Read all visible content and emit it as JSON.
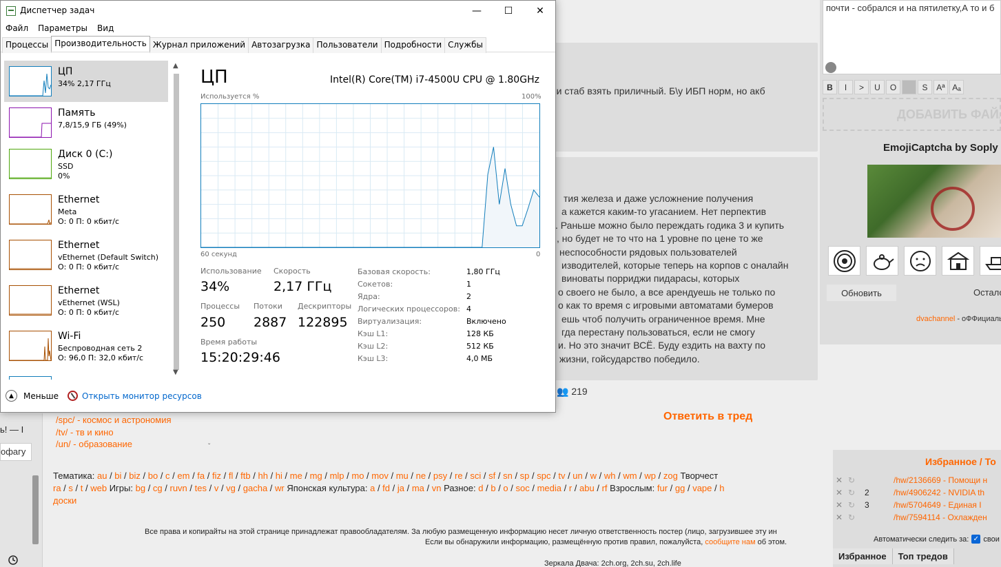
{
  "task_manager": {
    "window_title": "Диспетчер задач",
    "controls": {
      "minimize": "—",
      "maximize": "☐",
      "close": "✕"
    },
    "menu": [
      "Файл",
      "Параметры",
      "Вид"
    ],
    "tabs": [
      "Процессы",
      "Производительность",
      "Журнал приложений",
      "Автозагрузка",
      "Пользователи",
      "Подробности",
      "Службы"
    ],
    "active_tab": "Производительность",
    "sidebar": [
      {
        "name": "ЦП",
        "sub1": "34% 2,17 ГГц",
        "sub2": "",
        "color": "#117dbb",
        "selected": true
      },
      {
        "name": "Память",
        "sub1": "7,8/15,9 ГБ (49%)",
        "sub2": "",
        "color": "#8b12ae",
        "selected": false
      },
      {
        "name": "Диск 0 (C:)",
        "sub1": "SSD",
        "sub2": "0%",
        "color": "#4da60c",
        "selected": false
      },
      {
        "name": "Ethernet",
        "sub1": "Meta",
        "sub2": "О: 0 П: 0 кбит/с",
        "color": "#a74f01",
        "selected": false
      },
      {
        "name": "Ethernet",
        "sub1": "vEthernet (Default Switch)",
        "sub2": "О: 0 П: 0 кбит/с",
        "color": "#a74f01",
        "selected": false
      },
      {
        "name": "Ethernet",
        "sub1": "vEthernet (WSL)",
        "sub2": "О: 0 П: 0 кбит/с",
        "color": "#a74f01",
        "selected": false
      },
      {
        "name": "Wi-Fi",
        "sub1": "Беспроводная сеть 2",
        "sub2": "О: 96,0 П: 32,0 кбит/с",
        "color": "#a74f01",
        "selected": false
      }
    ],
    "cpu": {
      "title": "ЦП",
      "model": "Intel(R) Core(TM) i7-4500U CPU @ 1.80GHz",
      "graph_label_top_left": "Используется %",
      "graph_label_top_right": "100%",
      "graph_label_bottom_left": "60 секунд",
      "graph_label_bottom_right": "0",
      "usage_label": "Использование",
      "usage": "34%",
      "speed_label": "Скорость",
      "speed": "2,17 ГГц",
      "processes_label": "Процессы",
      "processes": "250",
      "threads_label": "Потоки",
      "threads": "2887",
      "handles_label": "Дескрипторы",
      "handles": "122895",
      "uptime_label": "Время работы",
      "uptime": "15:20:29:46",
      "details": [
        {
          "k": "Базовая скорость:",
          "v": "1,80 ГГц"
        },
        {
          "k": "Сокетов:",
          "v": "1"
        },
        {
          "k": "Ядра:",
          "v": "2"
        },
        {
          "k": "Логических процессоров:",
          "v": "4"
        },
        {
          "k": "Виртуализация:",
          "v": "Включено"
        },
        {
          "k": "Кэш L1:",
          "v": "128 КБ"
        },
        {
          "k": "Кэш L2:",
          "v": "512 КБ"
        },
        {
          "k": "Кэш L3:",
          "v": "4,0 МБ"
        }
      ],
      "graph_series_pct": [
        0,
        0,
        0,
        0,
        0,
        0,
        0,
        0,
        0,
        0,
        0,
        0,
        0,
        0,
        0,
        0,
        0,
        0,
        0,
        0,
        0,
        0,
        0,
        0,
        0,
        0,
        0,
        0,
        0,
        0,
        0,
        0,
        0,
        0,
        0,
        0,
        0,
        0,
        0,
        0,
        0,
        0,
        0,
        0,
        0,
        0,
        0,
        0,
        0,
        0,
        51,
        70,
        30,
        55,
        30,
        15,
        15,
        27,
        40,
        35
      ]
    },
    "fewer_details": "Меньше",
    "open_monitor": "Открыть монитор ресурсов"
  },
  "forum": {
    "post1_text": "о и стаб взять приличный. Б\\у ИБП норм, но акб",
    "post2_lines": [
      "тия железа и даже усложнение получения",
      "а кажется каким-то угасанием. Нет перпектив",
      ". Раньше можно было переждать годика 3 и купить",
      ", но будет не то что на 1 уровне по цене то же",
      "неспособности рядовых пользователей",
      "изводителей, которые теперь на корпов с оналайн",
      "виноваты порриджи пидарасы, которых",
      "о своего не было, а все арендуешь не только по",
      "о как то время с игровыми автоматами бумеров",
      "ешь чтоб получить ограниченное время. Мне",
      "гда перестану пользоваться, если не смогу",
      "и. Но это значит ВСЁ. Буду ездить на вахту по",
      "жизни, гойсударство победило."
    ],
    "counter": "219",
    "reply_in_thread": "Ответить в тред",
    "reply_box_text": "почти - собрался и на пятилетку,А то и б",
    "format_buttons": [
      "B",
      "I",
      ">",
      "U",
      "O",
      "",
      "S",
      "Aª",
      "Aₐ"
    ],
    "add_file": "ДОБАВИТЬ ФАЙЛ",
    "captcha_title": "EmojiCaptcha by Soply",
    "refresh": "Обновить",
    "remaining": "Остало",
    "dvachannel": "dvachannel",
    "dvachannel_suffix": " - оФФициаль",
    "boards": [
      "/spc/ - космос и астрономия",
      "/tv/ - тв и кино",
      "/un/ - образование"
    ],
    "left_text": "ь! — I",
    "left_box": "офагу",
    "themes_html_parts": {
      "tematika": "Тематика:",
      "tematika_links": [
        "au",
        "bi",
        "biz",
        "bo",
        "c",
        "em",
        "fa",
        "fiz",
        "fl",
        "ftb",
        "hh",
        "hi",
        "me",
        "mg",
        "mlp",
        "mo",
        "mov",
        "mu",
        "ne",
        "psy",
        "re",
        "sci",
        "sf",
        "sn",
        "sp",
        "spc",
        "tv",
        "un",
        "w",
        "wh",
        "wm",
        "wp",
        "zog"
      ],
      "tvorch": "Творчест",
      "tvorch_links": [
        "ra",
        "s",
        "t",
        "web"
      ],
      "games": "Игры:",
      "games_links": [
        "bg",
        "cg",
        "ruvn",
        "tes",
        "v",
        "vg",
        "gacha",
        "wr"
      ],
      "japan": "Японская культура:",
      "japan_links": [
        "a",
        "fd",
        "ja",
        "ma",
        "vn"
      ],
      "misc": "Разное:",
      "misc_links": [
        "d",
        "b",
        "o",
        "soc",
        "media",
        "r",
        "abu",
        "rf"
      ],
      "adult": "Взрослым:",
      "adult_links": [
        "fur",
        "gg",
        "vape",
        "h"
      ],
      "boards_word": "доски"
    },
    "footer1": "Все права и копирайты на этой странице принадлежат правообладателям. За любую размещенную информацию несет личную ответственность постер (лицо, загрузившее эту ин",
    "footer2_a": "Если вы обнаружили информацию, размещённую против правил, пожалуйста, ",
    "footer2_link": "сообщите нам",
    "footer2_b": " об этом.",
    "footer3": "Зеркала Двача: 2ch.org, 2ch.su, 2ch.life",
    "favorites_title": "Избранное / То",
    "favorites": [
      {
        "num": "",
        "link": "/hw/2136669 - Помощи н"
      },
      {
        "num": "2",
        "link": "/hw/4906242 - NVIDIA th"
      },
      {
        "num": "3",
        "link": "/hw/5704649 - Единая I"
      },
      {
        "num": "",
        "link": "/hw/7594114 - Охлажден"
      }
    ],
    "auto_follow": "Автоматически следить за:",
    "auto_follow_tail": "свои",
    "fav_tabs": [
      "Избранное",
      "Топ тредов"
    ]
  }
}
